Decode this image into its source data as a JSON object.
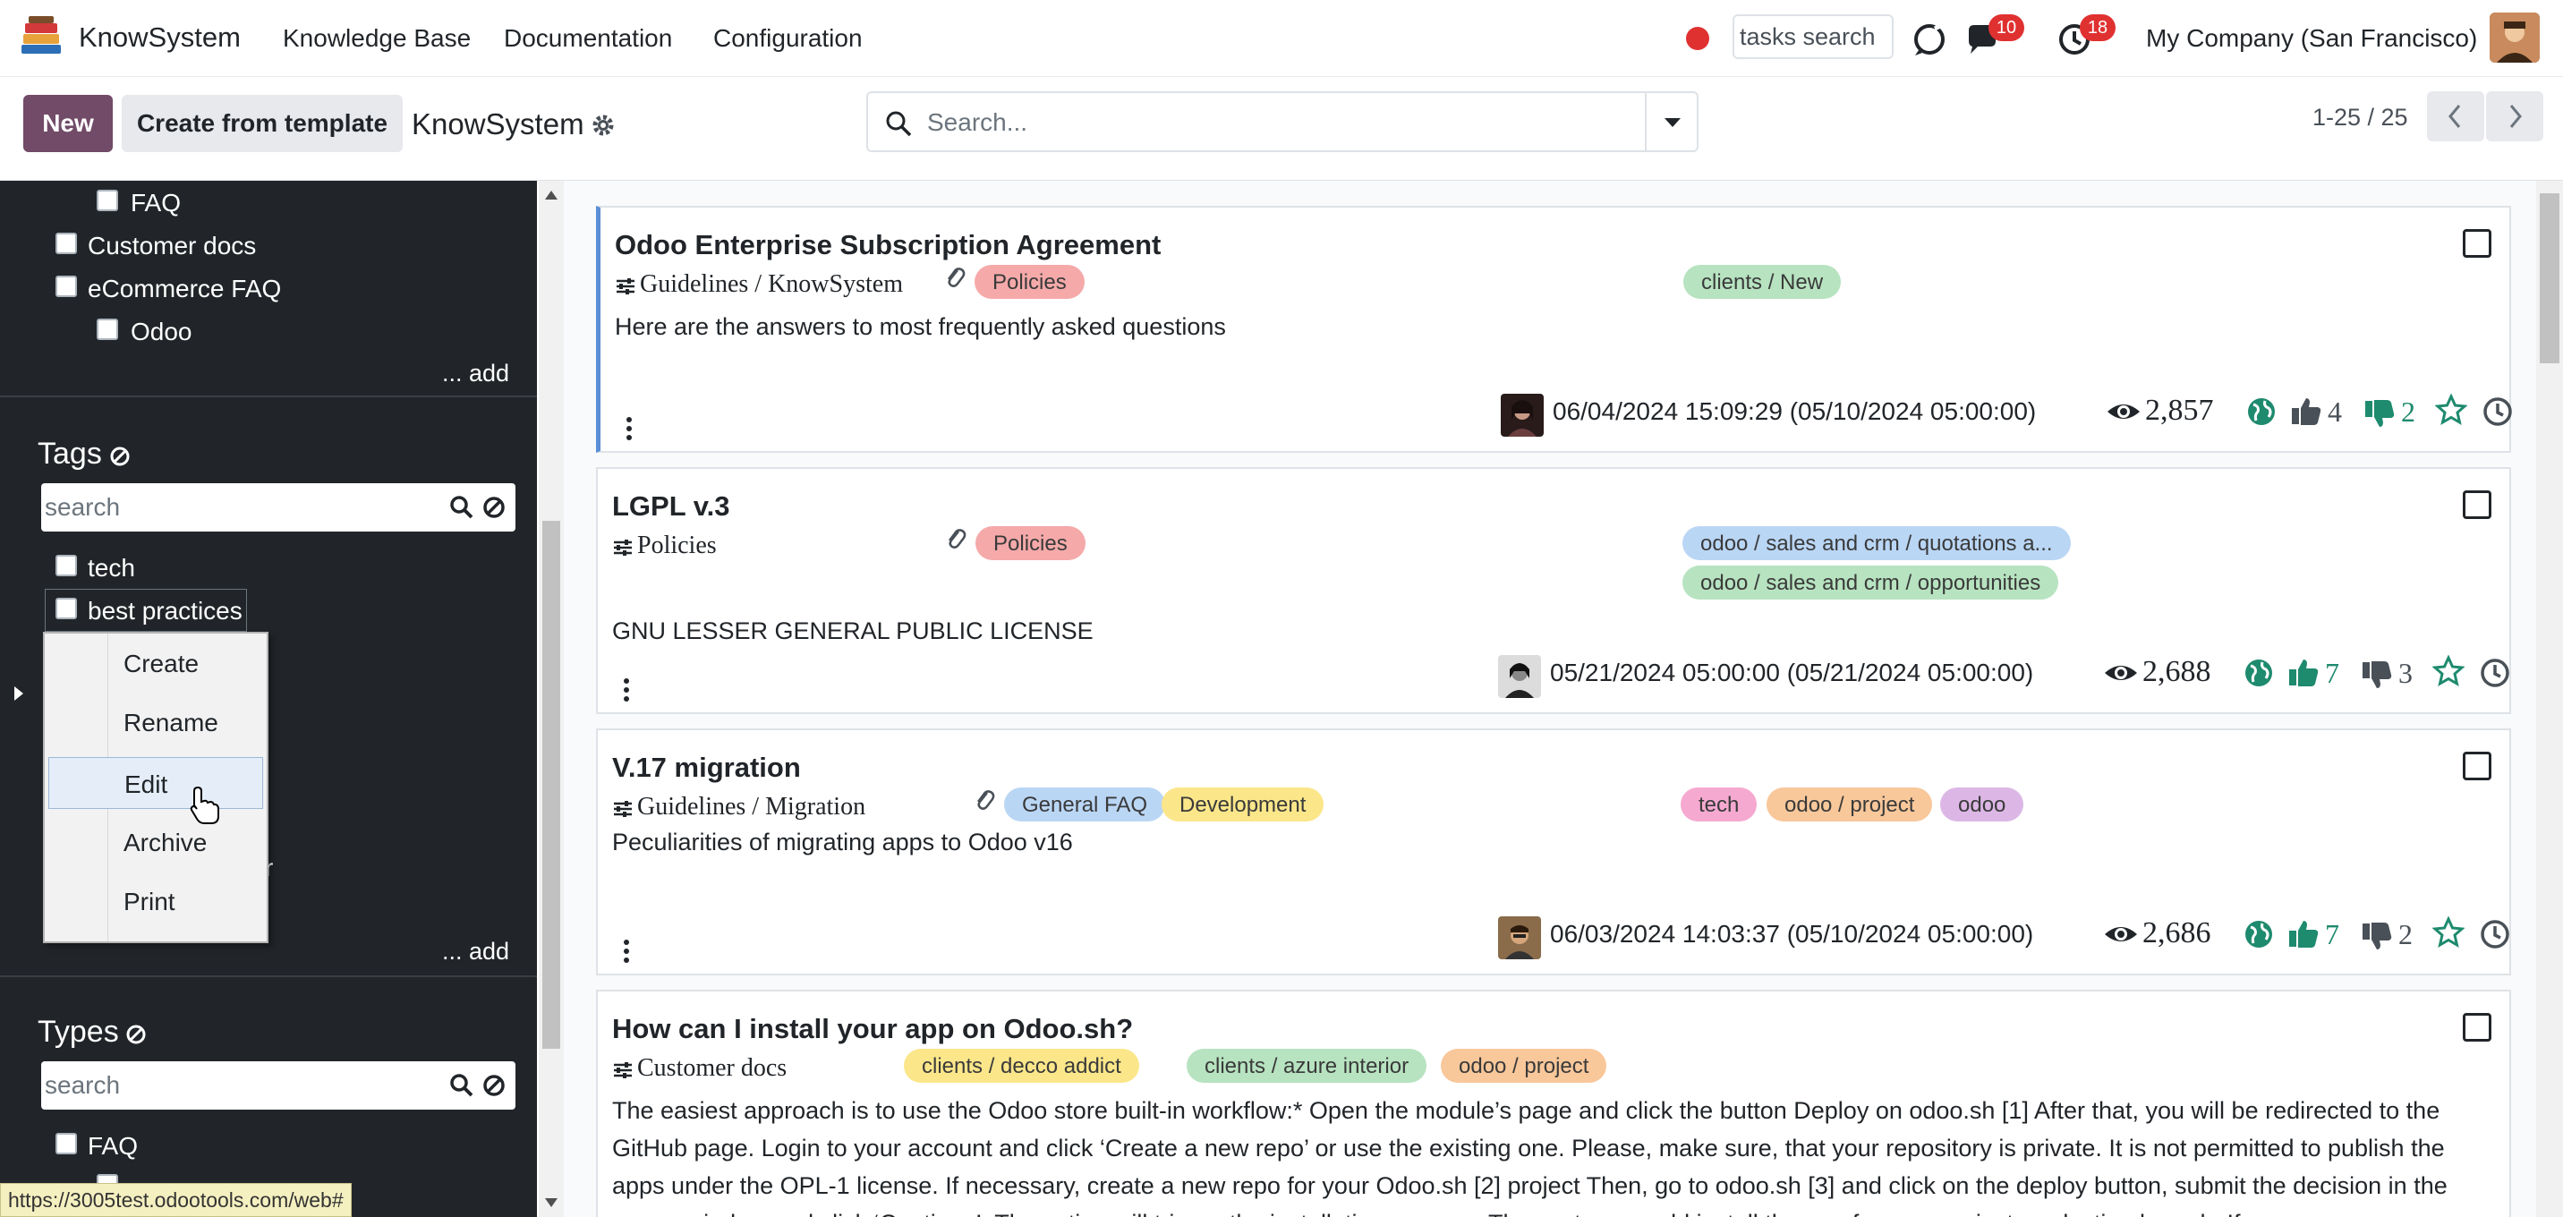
{
  "navbar": {
    "app_name": "KnowSystem",
    "menus": [
      "Knowledge Base",
      "Documentation",
      "Configuration"
    ],
    "tasks_search_placeholder": "tasks search",
    "messages_badge": "10",
    "activities_badge": "18",
    "company": "My Company (San Francisco)"
  },
  "control_panel": {
    "new_label": "New",
    "template_label": "Create from template",
    "title": "KnowSystem",
    "search_placeholder": "Search...",
    "pager": "1-25 / 25"
  },
  "sidebar": {
    "sections_items": [
      "FAQ",
      "Customer docs",
      "eCommerce FAQ",
      "Odoo"
    ],
    "add_label": "... add",
    "tags": {
      "heading": "Tags",
      "search_placeholder": "search",
      "items": [
        "tech",
        "best practices"
      ],
      "partial_label": "r"
    },
    "types": {
      "heading": "Types",
      "search_placeholder": "search",
      "items": [
        "FAQ"
      ]
    },
    "status_url": "https://3005test.odootools.com/web#"
  },
  "context_menu": {
    "items": [
      "Create",
      "Rename",
      "Edit",
      "Archive",
      "Print"
    ],
    "hovered": "Edit"
  },
  "colors": {
    "brand": "#714b67",
    "sidebar_bg": "#212529",
    "badge": "#e03131",
    "active_card_border": "#5b8fd6",
    "like_active": "#1e8a6e"
  },
  "cards": [
    {
      "title": "Odoo Enterprise Subscription Agreement",
      "path": "Guidelines / KnowSystem",
      "tags": [
        "Policies"
      ],
      "right_tags": [
        "clients / New"
      ],
      "description": "Here are the answers to most frequently asked questions",
      "date": "06/04/2024 15:09:29 (05/10/2024 05:00:00)",
      "views": "2,857",
      "likes": "4",
      "dislikes": "2"
    },
    {
      "title": "LGPL v.3",
      "path": "Policies",
      "tags": [
        "Policies"
      ],
      "right_tags": [
        "odoo / sales and crm / quotations a...",
        "odoo / sales and crm / opportunities"
      ],
      "description": "GNU LESSER GENERAL PUBLIC LICENSE",
      "date": "05/21/2024 05:00:00 (05/21/2024 05:00:00)",
      "views": "2,688",
      "likes": "7",
      "dislikes": "3"
    },
    {
      "title": "V.17 migration",
      "path": "Guidelines / Migration",
      "tags": [
        "General FAQ",
        "Development"
      ],
      "right_tags": [
        "tech",
        "odoo / project",
        "odoo"
      ],
      "description": "Peculiarities of migrating apps to Odoo v16",
      "date": "06/03/2024 14:03:37 (05/10/2024 05:00:00)",
      "views": "2,686",
      "likes": "7",
      "dislikes": "2"
    },
    {
      "title": "How can I install your app on Odoo.sh?",
      "path": "Customer docs",
      "tags": [
        "clients / decco addict",
        "clients / azure interior",
        "odoo / project"
      ],
      "description": "The easiest approach is to use the Odoo store built-in workflow:* Open the module’s page and click the button Deploy on odoo.sh [1] After that, you will be redirected to the GitHub page. Login to your account and click ‘Create a new repo’ or use the existing one. Please, make sure, that your repository is private. It is not permitted to publish the apps under the OPL-1 license. If necessary, create a new repo for your Odoo.sh [2] project Then, go to odoo.sh [3] and click on the deploy button, submit the decision in the popup window and click ‘Continue’. The action will trigger the installation process. These steps would install the app for your project production branch. If"
    }
  ]
}
